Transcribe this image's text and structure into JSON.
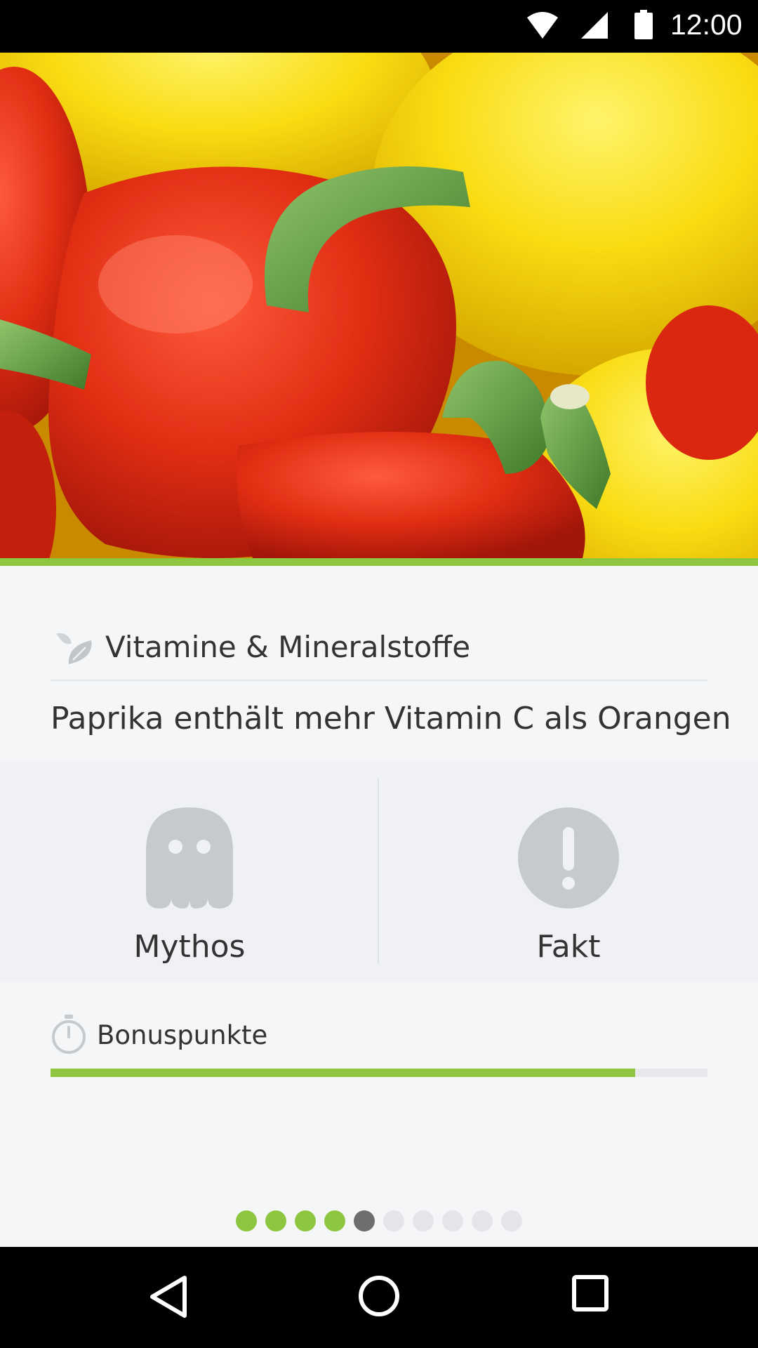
{
  "status_bar": {
    "time": "12:00",
    "icons": [
      "wifi-icon",
      "cell-signal-icon",
      "battery-icon"
    ]
  },
  "hero": {
    "image": "red-and-yellow-bell-peppers-photo",
    "accent_color": "#8dc63f"
  },
  "card": {
    "category": "Vitamine & Mineralstoffe",
    "category_icon": "leaf-icon",
    "statement": "Paprika enthält mehr Vitamin C als Orangen",
    "answers": [
      {
        "label": "Mythos",
        "icon": "ghost-icon"
      },
      {
        "label": "Fakt",
        "icon": "exclamation-circle-icon"
      }
    ],
    "bonus": {
      "label": "Bonuspunkte",
      "icon": "stopwatch-icon",
      "progress_fraction": 0.89
    }
  },
  "pager": {
    "total": 10,
    "current_index": 4,
    "completed": 4
  },
  "colors": {
    "accent": "#8dc63f",
    "icon_gray": "#c6cace",
    "current_dot": "#6e6e6e",
    "inactive_dot": "#e3e5e8"
  },
  "nav_bar": {
    "buttons": [
      "back-icon",
      "home-icon",
      "recents-icon"
    ]
  }
}
